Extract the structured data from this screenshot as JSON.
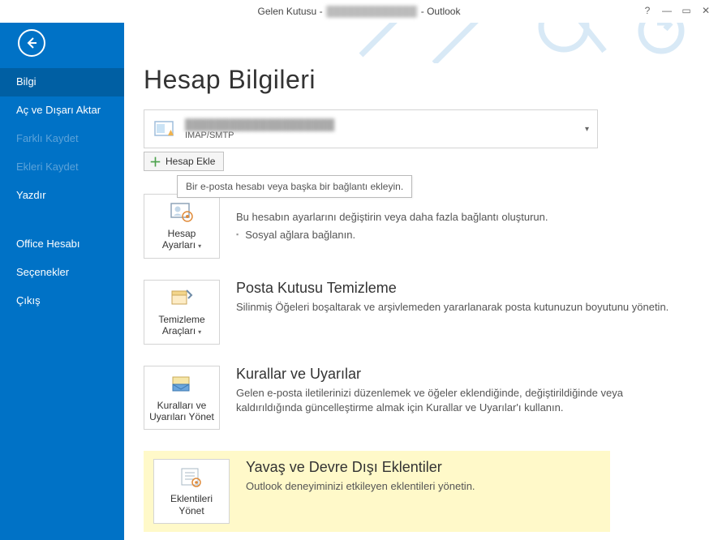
{
  "window": {
    "title_prefix": "Gelen Kutusu - ",
    "title_account": "█████████████",
    "title_suffix": " - Outlook"
  },
  "sidebar": {
    "items": [
      {
        "label": "Bilgi",
        "state": "selected"
      },
      {
        "label": "Aç ve Dışarı Aktar",
        "state": "normal"
      },
      {
        "label": "Farklı Kaydet",
        "state": "disabled"
      },
      {
        "label": "Ekleri Kaydet",
        "state": "disabled"
      },
      {
        "label": "Yazdır",
        "state": "normal"
      },
      {
        "label": "Office Hesabı",
        "state": "normal"
      },
      {
        "label": "Seçenekler",
        "state": "normal"
      },
      {
        "label": "Çıkış",
        "state": "normal"
      }
    ]
  },
  "page": {
    "title": "Hesap Bilgileri"
  },
  "account": {
    "email": "████████████████████",
    "protocol": "IMAP/SMTP"
  },
  "add_account": {
    "label": "Hesap Ekle",
    "tooltip": "Bir e-posta hesabı veya başka bir bağlantı ekleyin."
  },
  "sections": {
    "account_settings": {
      "button": "Hesap Ayarları",
      "desc": "Bu hesabın ayarlarını değiştirin veya daha fazla bağlantı oluşturun.",
      "bullet1": "Sosyal ağlara bağlanın."
    },
    "cleanup": {
      "button": "Temizleme Araçları",
      "heading": "Posta Kutusu Temizleme",
      "desc": "Silinmiş Öğeleri boşaltarak ve arşivlemeden yararlanarak posta kutunuzun boyutunu yönetin."
    },
    "rules": {
      "button": "Kuralları ve Uyarıları Yönet",
      "heading": "Kurallar ve Uyarılar",
      "desc": "Gelen e-posta iletilerinizi düzenlemek ve öğeler eklendiğinde, değiştirildiğinde veya kaldırıldığında güncelleştirme almak için Kurallar ve Uyarılar'ı kullanın."
    },
    "addins": {
      "button": "Eklentileri Yönet",
      "heading": "Yavaş ve Devre Dışı Eklentiler",
      "desc": "Outlook deneyiminizi etkileyen eklentileri yönetin."
    }
  }
}
